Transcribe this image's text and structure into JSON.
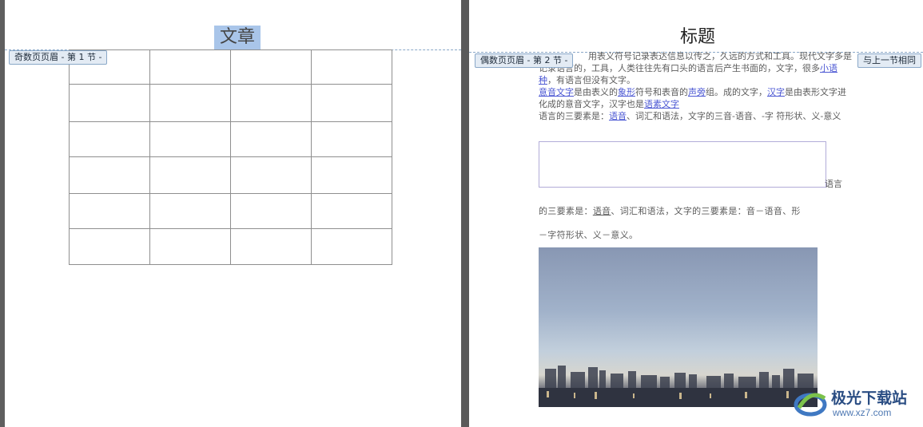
{
  "left_page": {
    "title": "文章",
    "header_label": "奇数页页眉 - 第 1 节 -",
    "table": {
      "rows": 6,
      "cols": 4
    }
  },
  "right_page": {
    "title": "标题",
    "header_label": "偶数页页眉 - 第 2 节 -",
    "link_previous_label": "与上一节相同",
    "para1_a": "用表义符号记录表达信息以传之，久远的方式和工具。现代文字多是记录语言的，工具，人类往往先有口头的语言后产生书面的，文字，很多",
    "para1_link1": "小语种",
    "para1_b": "，有语言但没有文字。",
    "para2_link1": "意音文字",
    "para2_a": "是由表义的",
    "para2_link2": "象形",
    "para2_b": "符号和表音的",
    "para2_link3": "声旁",
    "para2_c": "组。成的文字，",
    "para2_link4": "汉字",
    "para2_d": "是由表形文字进化成的意音文字，汉字也是",
    "para2_link5": "语素文字",
    "para3_a": "语言的三要素是：",
    "para3_link1": "语音",
    "para3_b": "、词汇和语法，文字的三音-语音、-字 符形状、义-意义",
    "box_tail": "语言",
    "para4_line1_a": "的三要素是：",
    "para4_line1_u": "语音",
    "para4_line1_b": "、词汇和语法，文字的三要素是：音－语音、形",
    "para4_line2": "－字符形状、义－意义。"
  },
  "watermark": {
    "name": "极光下载站",
    "url": "www.xz7.com"
  }
}
